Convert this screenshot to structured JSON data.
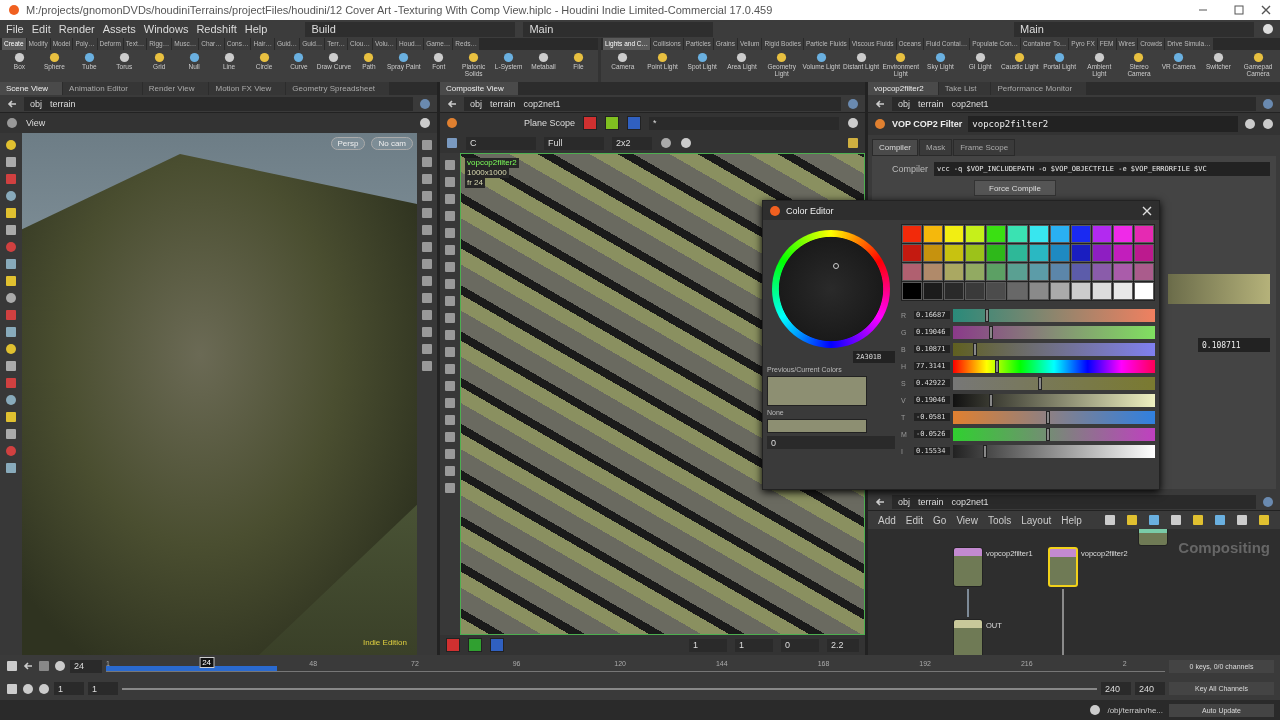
{
  "window": {
    "title": "M:/projects/gnomonDVDs/houdiniTerrains/projectFiles/houdini/12 Cover Art -Texturing With Comp View.hiplc - Houdini Indie Limited-Commercial 17.0.459"
  },
  "menu": [
    "File",
    "Edit",
    "Render",
    "Assets",
    "Windows",
    "Redshift",
    "Help"
  ],
  "desktop": "Build",
  "context": "Main",
  "right_context": "Main",
  "shelf_left": {
    "tabs": [
      {
        "label": "Create",
        "selected": true
      },
      {
        "label": "Modify",
        "selected": false
      },
      {
        "label": "Model",
        "selected": false
      },
      {
        "label": "Poly…",
        "selected": false
      },
      {
        "label": "Deform",
        "selected": false
      },
      {
        "label": "Text…",
        "selected": false
      },
      {
        "label": "Rigg…",
        "selected": false
      },
      {
        "label": "Musc…",
        "selected": false
      },
      {
        "label": "Char…",
        "selected": false
      },
      {
        "label": "Cons…",
        "selected": false
      },
      {
        "label": "Hair…",
        "selected": false
      },
      {
        "label": "Guid…",
        "selected": false
      },
      {
        "label": "Guid…",
        "selected": false
      },
      {
        "label": "Terr…",
        "selected": false
      },
      {
        "label": "Clou…",
        "selected": false
      },
      {
        "label": "Volu…",
        "selected": false
      },
      {
        "label": "Houd…",
        "selected": false
      },
      {
        "label": "Game…",
        "selected": false
      },
      {
        "label": "Reds…",
        "selected": false
      }
    ],
    "tools": [
      "Box",
      "Sphere",
      "Tube",
      "Torus",
      "Grid",
      "Null",
      "Line",
      "Circle",
      "Curve",
      "Draw Curve",
      "Path",
      "Spray Paint",
      "Font",
      "Platonic Solids",
      "L-System",
      "Metaball",
      "File"
    ]
  },
  "shelf_right": {
    "tabs": [
      {
        "label": "Lights and C…",
        "selected": true
      },
      {
        "label": "Collisions",
        "selected": false
      },
      {
        "label": "Particles",
        "selected": false
      },
      {
        "label": "Grains",
        "selected": false
      },
      {
        "label": "Vellum",
        "selected": false
      },
      {
        "label": "Rigid Bodies",
        "selected": false
      },
      {
        "label": "Particle Fluids",
        "selected": false
      },
      {
        "label": "Viscous Fluids",
        "selected": false
      },
      {
        "label": "Oceans",
        "selected": false
      },
      {
        "label": "Fluid Contai…",
        "selected": false
      },
      {
        "label": "Populate Con…",
        "selected": false
      },
      {
        "label": "Container To…",
        "selected": false
      },
      {
        "label": "Pyro FX",
        "selected": false
      },
      {
        "label": "FEM",
        "selected": false
      },
      {
        "label": "Wires",
        "selected": false
      },
      {
        "label": "Crowds",
        "selected": false
      },
      {
        "label": "Drive Simula…",
        "selected": false
      }
    ],
    "tools": [
      "Camera",
      "Point Light",
      "Spot Light",
      "Area Light",
      "Geometry Light",
      "Volume Light",
      "Distant Light",
      "Environment Light",
      "Sky Light",
      "GI Light",
      "Caustic Light",
      "Portal Light",
      "Ambient Light",
      "Stereo Camera",
      "VR Camera",
      "Switcher",
      "Gamepad Camera"
    ]
  },
  "scene_view": {
    "tabs": [
      {
        "label": "Scene View",
        "selected": true
      },
      {
        "label": "Animation Editor",
        "selected": false
      },
      {
        "label": "Render View",
        "selected": false
      },
      {
        "label": "Motion FX View",
        "selected": false
      },
      {
        "label": "Geometry Spreadsheet",
        "selected": false
      }
    ],
    "path": [
      "obj",
      "terrain"
    ],
    "title": "View",
    "buttons": [
      "Persp",
      "No cam"
    ],
    "watermark": "Indie Edition"
  },
  "composite_view": {
    "tabs": [
      {
        "label": "Composite View",
        "selected": true
      }
    ],
    "path": [
      "obj",
      "terrain",
      "cop2net1"
    ],
    "plane_scope": "Plane Scope",
    "plane_field": "*",
    "dropdowns": [
      "C",
      "Full",
      "2x2"
    ],
    "overlay": [
      "vopcop2filter2",
      "1000x1000",
      "fr 24"
    ],
    "bottom_fields": [
      "1",
      "1",
      "0",
      "2.2"
    ]
  },
  "parameters": {
    "tabs": [
      {
        "label": "vopcop2filter2",
        "selected": true
      },
      {
        "label": "Take List",
        "selected": false
      },
      {
        "label": "Performance Monitor",
        "selected": false
      }
    ],
    "path": [
      "obj",
      "terrain",
      "cop2net1"
    ],
    "node_type": "VOP COP2 Filter",
    "node_name": "vopcop2filter2",
    "param_tabs": [
      {
        "label": "Compiler",
        "selected": true
      },
      {
        "label": "Mask",
        "selected": false
      },
      {
        "label": "Frame Scope",
        "selected": false
      }
    ],
    "compiler_label": "Compiler",
    "compiler_value": "vcc -q $VOP_INCLUDEPATH -o $VOP_OBJECTFILE -e $VOP_ERRORFILE $VC",
    "force_compile": "Force Compile",
    "value": "0.108711"
  },
  "network": {
    "path": [
      "obj",
      "terrain",
      "cop2net1"
    ],
    "menu": [
      "Add",
      "Edit",
      "Go",
      "View",
      "Tools",
      "Layout",
      "Help"
    ],
    "context_label": "Compositing",
    "nodes": [
      {
        "label": "vopcop2filter1",
        "kind": "filter",
        "selected": false
      },
      {
        "label": "vopcop2filter2",
        "kind": "filter",
        "selected": true
      },
      {
        "label": "OUT",
        "kind": "null",
        "selected": false
      },
      {
        "kind": "file",
        "selected": false
      }
    ]
  },
  "color_editor": {
    "title": "Color Editor",
    "hex": "2A301B",
    "previous_label": "Previous/Current Colors",
    "none_label": "None",
    "none_value": "0",
    "swatches": [
      {
        "color": "#f22a0a"
      },
      {
        "color": "#f5b80c"
      },
      {
        "color": "#f2ee12"
      },
      {
        "color": "#c6f01a"
      },
      {
        "color": "#3ae012"
      },
      {
        "color": "#3ae2b2"
      },
      {
        "color": "#38e6ef"
      },
      {
        "color": "#2ab0f2"
      },
      {
        "color": "#1a2af2"
      },
      {
        "color": "#b22af0"
      },
      {
        "color": "#ef2ae8"
      },
      {
        "color": "#e52ab2"
      },
      {
        "color": "#c41a10"
      },
      {
        "color": "#c6920e"
      },
      {
        "color": "#c8c210"
      },
      {
        "color": "#9cc21a"
      },
      {
        "color": "#2eb81a"
      },
      {
        "color": "#2eb898"
      },
      {
        "color": "#2ab8c2"
      },
      {
        "color": "#1e8ac2"
      },
      {
        "color": "#1a1ec0"
      },
      {
        "color": "#8e1ec2"
      },
      {
        "color": "#c21ebc"
      },
      {
        "color": "#bc1a8e"
      },
      {
        "color": "#b06070"
      },
      {
        "color": "#b08a6a"
      },
      {
        "color": "#aaa862"
      },
      {
        "color": "#92aa62"
      },
      {
        "color": "#5ca064"
      },
      {
        "color": "#5aa092"
      },
      {
        "color": "#5c9ca8"
      },
      {
        "color": "#5c86aa"
      },
      {
        "color": "#5c5caa"
      },
      {
        "color": "#8a5caa"
      },
      {
        "color": "#aa5caa"
      },
      {
        "color": "#aa5c8c"
      },
      {
        "color": "#000000"
      },
      {
        "color": "#1c1c1c"
      },
      {
        "color": "#2a2a2a"
      },
      {
        "color": "#3a3a3a"
      },
      {
        "color": "#4c4c4c"
      },
      {
        "color": "#686868"
      },
      {
        "color": "#8a8a8a"
      },
      {
        "color": "#aaaaaa"
      },
      {
        "color": "#cccccc"
      },
      {
        "color": "#dddddd"
      },
      {
        "color": "#e8e8e8"
      },
      {
        "color": "#ffffff"
      }
    ],
    "sliders": [
      {
        "label": "R",
        "value": "0.16687",
        "level": 0.17
      },
      {
        "label": "G",
        "value": "0.19046",
        "level": 0.19
      },
      {
        "label": "B",
        "value": "0.10871",
        "level": 0.11
      },
      {
        "label": "H",
        "value": "77.3141",
        "level": 0.22
      },
      {
        "label": "S",
        "value": "0.42922",
        "level": 0.43
      },
      {
        "label": "V",
        "value": "0.19046",
        "level": 0.19
      },
      {
        "label": "T",
        "value": "-0.0581",
        "level": 0.47
      },
      {
        "label": "M",
        "value": "-0.0526",
        "level": 0.47
      },
      {
        "label": "I",
        "value": "0.15534",
        "level": 0.16
      }
    ]
  },
  "timeline": {
    "frame": "24",
    "playhead": {
      "label": "24",
      "level": 0.095
    },
    "ticks": [
      "1",
      "48",
      "72",
      "96",
      "120",
      "144",
      "168",
      "192",
      "216",
      "2"
    ],
    "start": [
      "1",
      "1"
    ],
    "end": [
      "240",
      "240"
    ],
    "keys": "0 keys, 0/0 channels",
    "key_all": "Key All Channels"
  },
  "status": {
    "path": "/obj/terrain/he...",
    "update": "Auto Update"
  }
}
